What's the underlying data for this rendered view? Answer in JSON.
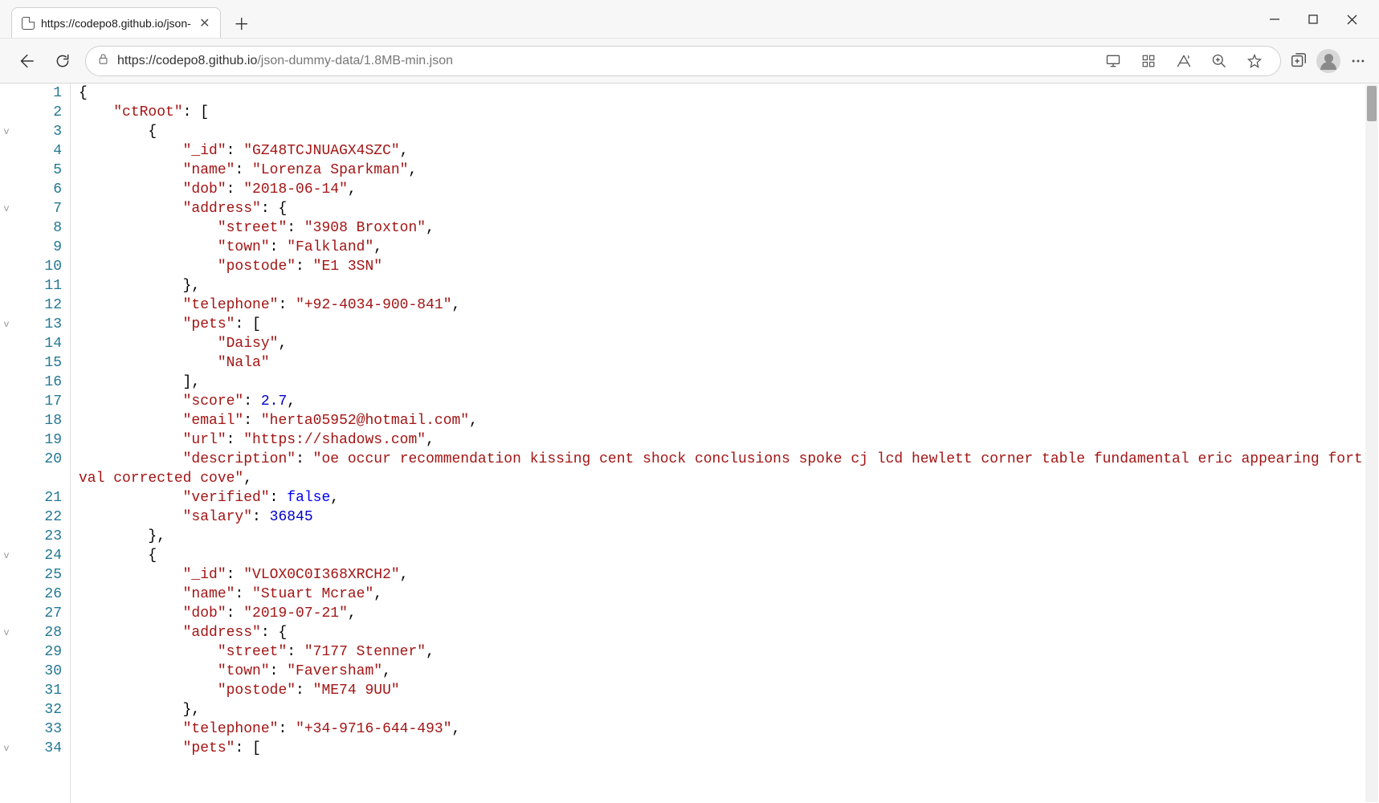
{
  "tab": {
    "title": "https://codepo8.github.io/json-"
  },
  "url_host": "https://codepo8.github.io",
  "url_path": "/json-dummy-data/1.8MB-min.json",
  "code_lines": [
    {
      "n": 1,
      "fold": "",
      "tokens": [
        [
          "p",
          "{"
        ]
      ]
    },
    {
      "n": 2,
      "fold": "",
      "tokens": [
        [
          "p",
          "    "
        ],
        [
          "k",
          "\"ctRoot\""
        ],
        [
          "p",
          ": ["
        ]
      ]
    },
    {
      "n": 3,
      "fold": "v",
      "tokens": [
        [
          "p",
          "        {"
        ]
      ]
    },
    {
      "n": 4,
      "fold": "",
      "tokens": [
        [
          "p",
          "            "
        ],
        [
          "k",
          "\"_id\""
        ],
        [
          "p",
          ": "
        ],
        [
          "s",
          "\"GZ48TCJNUAGX4SZC\""
        ],
        [
          "p",
          ","
        ]
      ]
    },
    {
      "n": 5,
      "fold": "",
      "tokens": [
        [
          "p",
          "            "
        ],
        [
          "k",
          "\"name\""
        ],
        [
          "p",
          ": "
        ],
        [
          "s",
          "\"Lorenza Sparkman\""
        ],
        [
          "p",
          ","
        ]
      ]
    },
    {
      "n": 6,
      "fold": "",
      "tokens": [
        [
          "p",
          "            "
        ],
        [
          "k",
          "\"dob\""
        ],
        [
          "p",
          ": "
        ],
        [
          "s",
          "\"2018-06-14\""
        ],
        [
          "p",
          ","
        ]
      ]
    },
    {
      "n": 7,
      "fold": "v",
      "tokens": [
        [
          "p",
          "            "
        ],
        [
          "k",
          "\"address\""
        ],
        [
          "p",
          ": {"
        ]
      ]
    },
    {
      "n": 8,
      "fold": "",
      "tokens": [
        [
          "p",
          "                "
        ],
        [
          "k",
          "\"street\""
        ],
        [
          "p",
          ": "
        ],
        [
          "s",
          "\"3908 Broxton\""
        ],
        [
          "p",
          ","
        ]
      ]
    },
    {
      "n": 9,
      "fold": "",
      "tokens": [
        [
          "p",
          "                "
        ],
        [
          "k",
          "\"town\""
        ],
        [
          "p",
          ": "
        ],
        [
          "s",
          "\"Falkland\""
        ],
        [
          "p",
          ","
        ]
      ]
    },
    {
      "n": 10,
      "fold": "",
      "tokens": [
        [
          "p",
          "                "
        ],
        [
          "k",
          "\"postode\""
        ],
        [
          "p",
          ": "
        ],
        [
          "s",
          "\"E1 3SN\""
        ]
      ]
    },
    {
      "n": 11,
      "fold": "",
      "tokens": [
        [
          "p",
          "            },"
        ]
      ]
    },
    {
      "n": 12,
      "fold": "",
      "tokens": [
        [
          "p",
          "            "
        ],
        [
          "k",
          "\"telephone\""
        ],
        [
          "p",
          ": "
        ],
        [
          "s",
          "\"+92-4034-900-841\""
        ],
        [
          "p",
          ","
        ]
      ]
    },
    {
      "n": 13,
      "fold": "v",
      "tokens": [
        [
          "p",
          "            "
        ],
        [
          "k",
          "\"pets\""
        ],
        [
          "p",
          ": ["
        ]
      ]
    },
    {
      "n": 14,
      "fold": "",
      "tokens": [
        [
          "p",
          "                "
        ],
        [
          "s",
          "\"Daisy\""
        ],
        [
          "p",
          ","
        ]
      ]
    },
    {
      "n": 15,
      "fold": "",
      "tokens": [
        [
          "p",
          "                "
        ],
        [
          "s",
          "\"Nala\""
        ]
      ]
    },
    {
      "n": 16,
      "fold": "",
      "tokens": [
        [
          "p",
          "            ],"
        ]
      ]
    },
    {
      "n": 17,
      "fold": "",
      "tokens": [
        [
          "p",
          "            "
        ],
        [
          "k",
          "\"score\""
        ],
        [
          "p",
          ": "
        ],
        [
          "n",
          "2.7"
        ],
        [
          "p",
          ","
        ]
      ]
    },
    {
      "n": 18,
      "fold": "",
      "tokens": [
        [
          "p",
          "            "
        ],
        [
          "k",
          "\"email\""
        ],
        [
          "p",
          ": "
        ],
        [
          "s",
          "\"herta05952@hotmail.com\""
        ],
        [
          "p",
          ","
        ]
      ]
    },
    {
      "n": 19,
      "fold": "",
      "tokens": [
        [
          "p",
          "            "
        ],
        [
          "k",
          "\"url\""
        ],
        [
          "p",
          ": "
        ],
        [
          "s",
          "\"https://shadows.com\""
        ],
        [
          "p",
          ","
        ]
      ]
    },
    {
      "n": 20,
      "fold": "",
      "wrap": true,
      "tokens": [
        [
          "p",
          "            "
        ],
        [
          "k",
          "\"description\""
        ],
        [
          "p",
          ": "
        ],
        [
          "s",
          "\"oe occur recommendation kissing cent shock conclusions spoke cj lcd hewlett corner table fundamental eric appearing fort val corrected cove\""
        ],
        [
          "p",
          ","
        ]
      ]
    },
    {
      "n": 21,
      "fold": "",
      "tokens": [
        [
          "p",
          "            "
        ],
        [
          "k",
          "\"verified\""
        ],
        [
          "p",
          ": "
        ],
        [
          "b",
          "false"
        ],
        [
          "p",
          ","
        ]
      ]
    },
    {
      "n": 22,
      "fold": "",
      "tokens": [
        [
          "p",
          "            "
        ],
        [
          "k",
          "\"salary\""
        ],
        [
          "p",
          ": "
        ],
        [
          "n",
          "36845"
        ]
      ]
    },
    {
      "n": 23,
      "fold": "",
      "tokens": [
        [
          "p",
          "        },"
        ]
      ]
    },
    {
      "n": 24,
      "fold": "v",
      "tokens": [
        [
          "p",
          "        {"
        ]
      ]
    },
    {
      "n": 25,
      "fold": "",
      "tokens": [
        [
          "p",
          "            "
        ],
        [
          "k",
          "\"_id\""
        ],
        [
          "p",
          ": "
        ],
        [
          "s",
          "\"VLOX0C0I368XRCH2\""
        ],
        [
          "p",
          ","
        ]
      ]
    },
    {
      "n": 26,
      "fold": "",
      "tokens": [
        [
          "p",
          "            "
        ],
        [
          "k",
          "\"name\""
        ],
        [
          "p",
          ": "
        ],
        [
          "s",
          "\"Stuart Mcrae\""
        ],
        [
          "p",
          ","
        ]
      ]
    },
    {
      "n": 27,
      "fold": "",
      "tokens": [
        [
          "p",
          "            "
        ],
        [
          "k",
          "\"dob\""
        ],
        [
          "p",
          ": "
        ],
        [
          "s",
          "\"2019-07-21\""
        ],
        [
          "p",
          ","
        ]
      ]
    },
    {
      "n": 28,
      "fold": "v",
      "tokens": [
        [
          "p",
          "            "
        ],
        [
          "k",
          "\"address\""
        ],
        [
          "p",
          ": {"
        ]
      ]
    },
    {
      "n": 29,
      "fold": "",
      "tokens": [
        [
          "p",
          "                "
        ],
        [
          "k",
          "\"street\""
        ],
        [
          "p",
          ": "
        ],
        [
          "s",
          "\"7177 Stenner\""
        ],
        [
          "p",
          ","
        ]
      ]
    },
    {
      "n": 30,
      "fold": "",
      "tokens": [
        [
          "p",
          "                "
        ],
        [
          "k",
          "\"town\""
        ],
        [
          "p",
          ": "
        ],
        [
          "s",
          "\"Faversham\""
        ],
        [
          "p",
          ","
        ]
      ]
    },
    {
      "n": 31,
      "fold": "",
      "tokens": [
        [
          "p",
          "                "
        ],
        [
          "k",
          "\"postode\""
        ],
        [
          "p",
          ": "
        ],
        [
          "s",
          "\"ME74 9UU\""
        ]
      ]
    },
    {
      "n": 32,
      "fold": "",
      "tokens": [
        [
          "p",
          "            },"
        ]
      ]
    },
    {
      "n": 33,
      "fold": "",
      "tokens": [
        [
          "p",
          "            "
        ],
        [
          "k",
          "\"telephone\""
        ],
        [
          "p",
          ": "
        ],
        [
          "s",
          "\"+34-9716-644-493\""
        ],
        [
          "p",
          ","
        ]
      ]
    },
    {
      "n": 34,
      "fold": "v",
      "tokens": [
        [
          "p",
          "            "
        ],
        [
          "k",
          "\"pets\""
        ],
        [
          "p",
          ": ["
        ]
      ]
    }
  ]
}
